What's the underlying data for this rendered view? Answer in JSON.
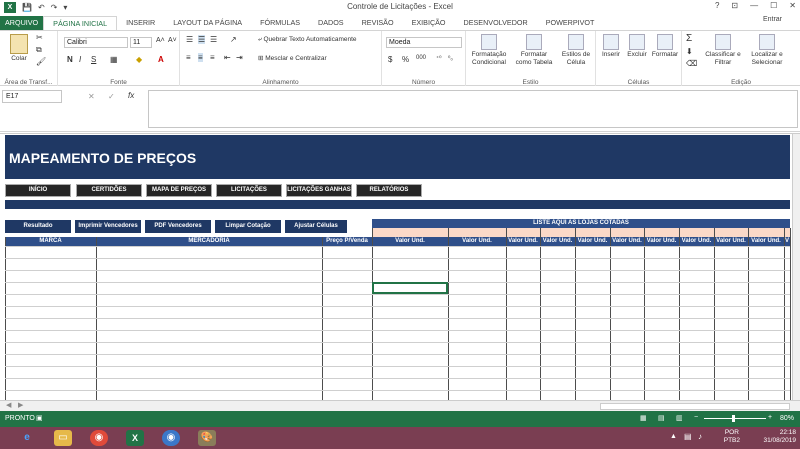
{
  "window": {
    "title": "Controle de Licitações - Excel",
    "help": "?",
    "restore": "⊡",
    "minimize": "—",
    "maximize": "☐",
    "close": "✕",
    "signin": "Entrar"
  },
  "tabs": [
    "ARQUIVO",
    "PÁGINA INICIAL",
    "INSERIR",
    "LAYOUT DA PÁGINA",
    "FÓRMULAS",
    "DADOS",
    "REVISÃO",
    "EXIBIÇÃO",
    "DESENVOLVEDOR",
    "POWERPIVOT"
  ],
  "ribbon": {
    "paste_label": "Colar",
    "clipboard_label": "Área de Transf...",
    "font_name": "Calibri",
    "font_size": "11",
    "font_label": "Fonte",
    "bold": "N",
    "italic": "I",
    "underline": "S",
    "wrap_text": "Quebrar Texto Automaticamente",
    "merge_center": "Mesclar e Centralizar",
    "alignment_label": "Alinhamento",
    "number_format": "Moeda",
    "number_label": "Número",
    "cond_format": "Formatação Condicional",
    "format_table": "Formatar como Tabela",
    "cell_styles": "Estilos de Célula",
    "style_label": "Estilo",
    "insert": "Inserir",
    "delete": "Excluir",
    "format": "Formatar",
    "cells_label": "Células",
    "sort_filter": "Classificar e Filtrar",
    "find_select": "Localizar e Selecionar",
    "edit_label": "Edição",
    "percent": "%",
    "thousands": "000"
  },
  "formula_bar": {
    "name_box": "E17",
    "fx": "fx",
    "cancel": "✕",
    "enter": "✓"
  },
  "sheet": {
    "title": "MAPEAMENTO DE PREÇOS",
    "nav_buttons": [
      "INÍCIO",
      "CERTIDÕES",
      "MAPA DE PREÇOS",
      "LICITAÇÕES",
      "LICITAÇÕES GANHAS",
      "RELATÓRIOS"
    ],
    "action_buttons": [
      "Resultado",
      "Imprimir Vencedores",
      "PDF Vencedores",
      "Limpar Cotação",
      "Ajustar Células"
    ],
    "lojas_header": "LISTE AQUI AS LOJAS COTADAS",
    "columns": [
      "MARCA",
      "MERCADORIA",
      "Preço P/Venda",
      "Valor Und.",
      "Valor Und.",
      "Valor Und.",
      "Valor Und.",
      "Valor Und.",
      "Valor Und.",
      "Valor Und.",
      "Valor Und.",
      "Valor Und.",
      "Valor Und.",
      "V"
    ]
  },
  "status": {
    "ready": "PRONTO",
    "zoom": "80%"
  },
  "taskbar": {
    "lang": "POR",
    "layout": "PTB2",
    "time": "22:18",
    "date": "31/08/2019"
  },
  "colors": {
    "excel_green": "#217346",
    "header_navy": "#1f3864",
    "column_blue": "#2f4f8a",
    "peach": "#fbd9c8"
  }
}
